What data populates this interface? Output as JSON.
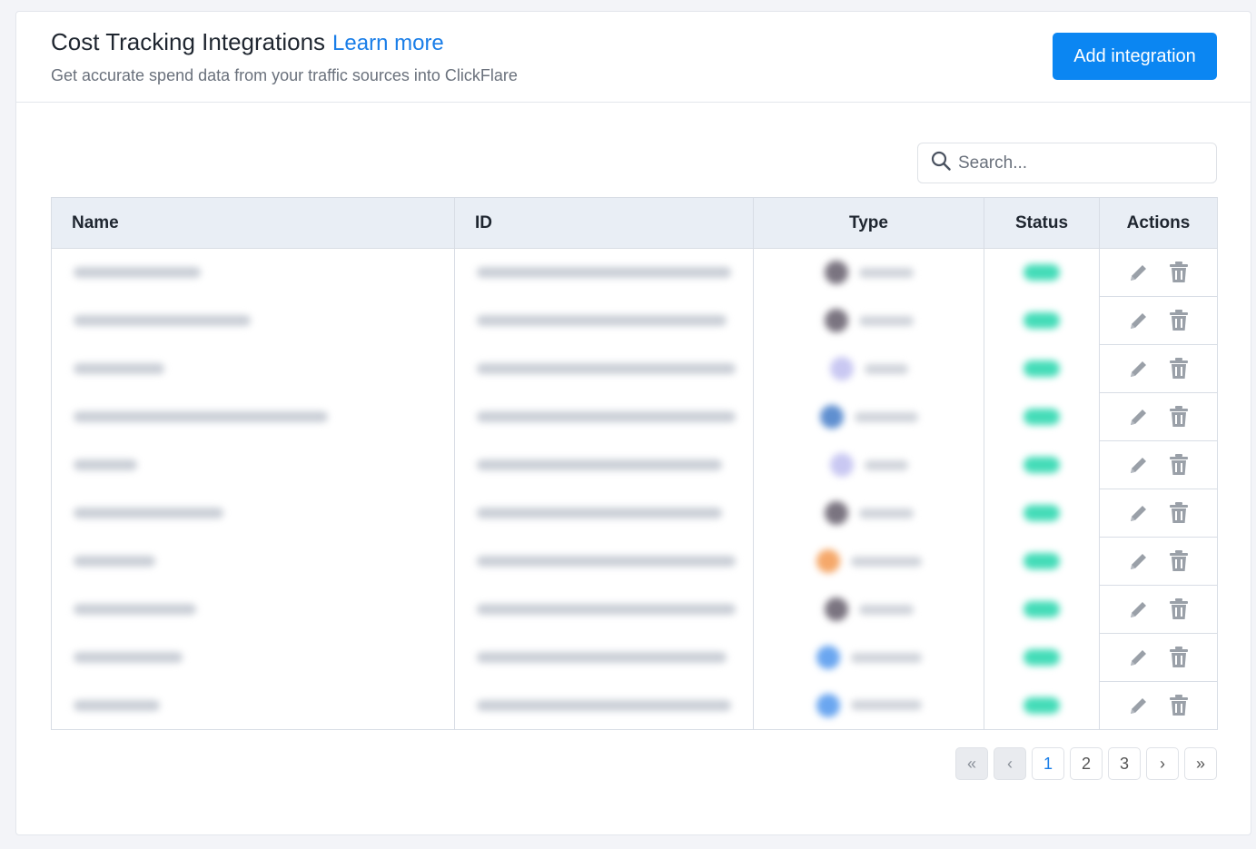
{
  "header": {
    "title": "Cost Tracking Integrations",
    "learn_more": "Learn more",
    "subtitle": "Get accurate spend data from your traffic sources into ClickFlare",
    "add_button": "Add integration"
  },
  "search": {
    "placeholder": "Search...",
    "value": ""
  },
  "table": {
    "columns": [
      "Name",
      "ID",
      "Type",
      "Status",
      "Actions"
    ],
    "row_count": 10,
    "note_rows_blurred": true,
    "type_logo_colors": [
      "#7a7480",
      "#7a7480",
      "#c9c8f2",
      "#5f8fd0",
      "#c9c8f2",
      "#7a7480",
      "#f5a86a",
      "#7a7480",
      "#6aa6f0",
      "#6aa6f0"
    ],
    "status_color": "#44dcb8",
    "actions": {
      "edit_icon": "pencil-icon",
      "delete_icon": "trash-icon"
    }
  },
  "pagination": {
    "first": "«",
    "prev": "‹",
    "pages": [
      "1",
      "2",
      "3"
    ],
    "next": "›",
    "last": "»"
  }
}
